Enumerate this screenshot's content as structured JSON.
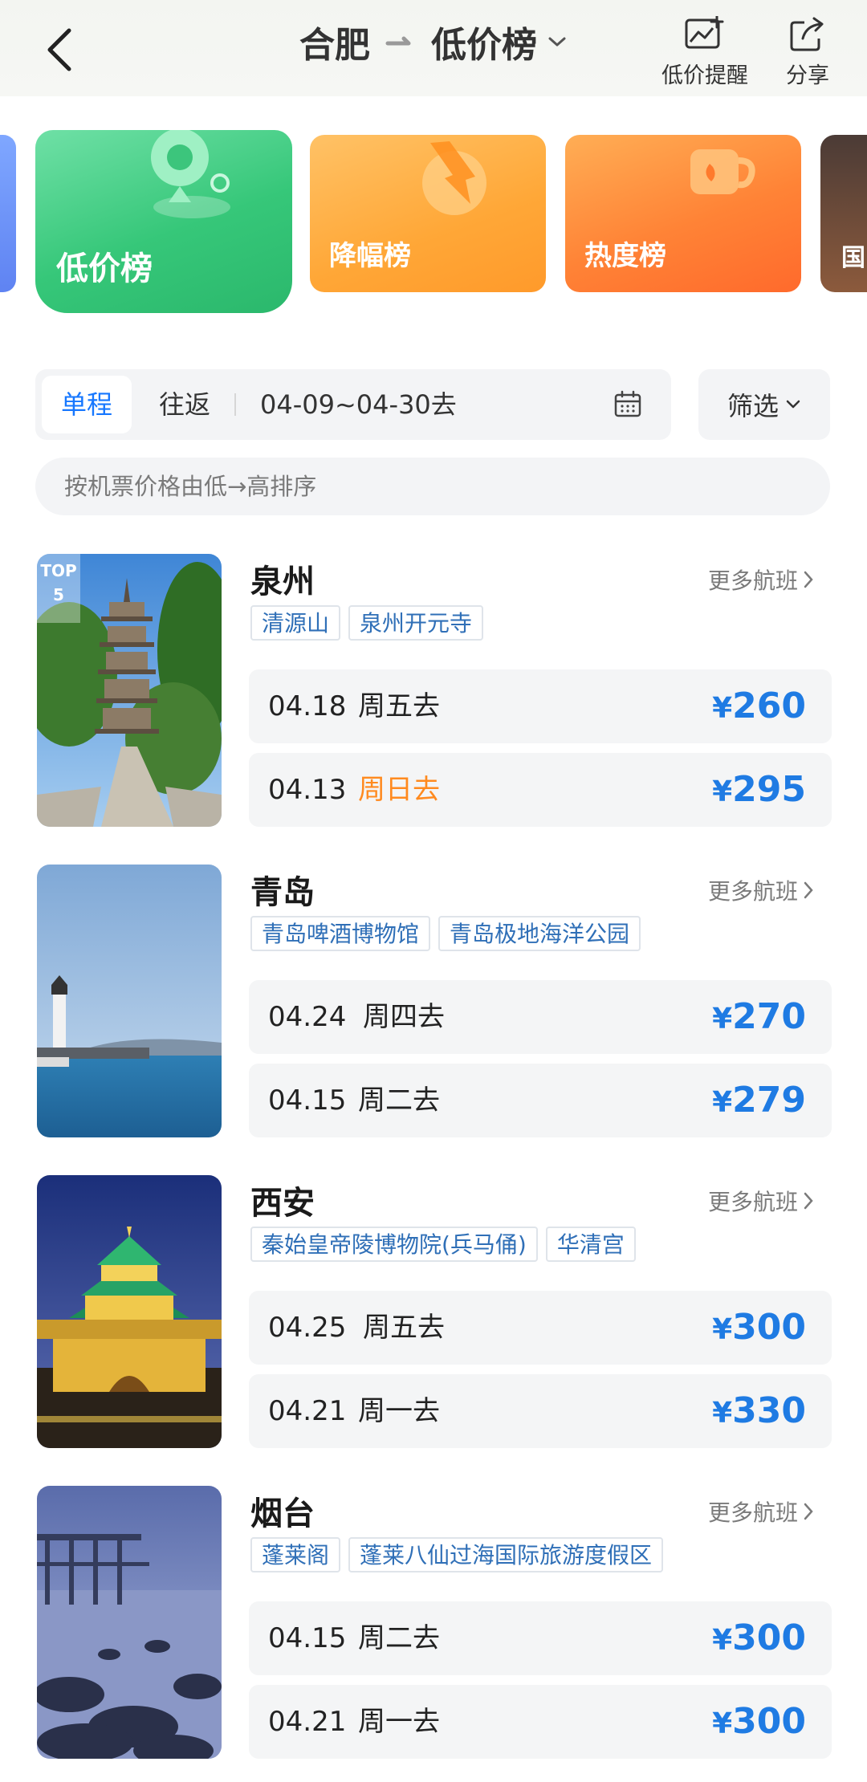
{
  "header": {
    "origin": "合肥",
    "title": "低价榜",
    "actions": {
      "alert_label": "低价提醒",
      "share_label": "分享"
    }
  },
  "ranks": {
    "low_price": "低价榜",
    "price_drop": "降幅榜",
    "popularity": "热度榜",
    "partial_next": "国"
  },
  "trip": {
    "one_way": "单程",
    "round_trip": "往返",
    "date_range": "04-09~04-30去",
    "filter": "筛选"
  },
  "sort_hint": "按机票价格由低→高排序",
  "more_label": "更多航班",
  "top_badge": {
    "line1": "TOP",
    "line2": "5"
  },
  "destinations": [
    {
      "name": "泉州",
      "tags": [
        "清源山",
        "泉州开元寺"
      ],
      "flights": [
        {
          "date": "04.18",
          "weekday": "周五去",
          "weekend": false,
          "currency": "¥",
          "price": "260"
        },
        {
          "date": "04.13",
          "weekday": "周日去",
          "weekend": true,
          "currency": "¥",
          "price": "295"
        }
      ]
    },
    {
      "name": "青岛",
      "tags": [
        "青岛啤酒博物馆",
        "青岛极地海洋公园"
      ],
      "flights": [
        {
          "date": "04.24",
          "weekday": "周四去",
          "weekend": false,
          "currency": "¥",
          "price": "270"
        },
        {
          "date": "04.15",
          "weekday": "周二去",
          "weekend": false,
          "currency": "¥",
          "price": "279"
        }
      ]
    },
    {
      "name": "西安",
      "tags": [
        "秦始皇帝陵博物院(兵马俑)",
        "华清宫"
      ],
      "flights": [
        {
          "date": "04.25",
          "weekday": "周五去",
          "weekend": false,
          "currency": "¥",
          "price": "300"
        },
        {
          "date": "04.21",
          "weekday": "周一去",
          "weekend": false,
          "currency": "¥",
          "price": "330"
        }
      ]
    },
    {
      "name": "烟台",
      "tags": [
        "蓬莱阁",
        "蓬莱八仙过海国际旅游度假区"
      ],
      "flights": [
        {
          "date": "04.15",
          "weekday": "周二去",
          "weekend": false,
          "currency": "¥",
          "price": "300"
        },
        {
          "date": "04.21",
          "weekday": "周一去",
          "weekend": false,
          "currency": "¥",
          "price": "300"
        }
      ]
    }
  ],
  "colors": {
    "accent": "#1677ff",
    "price": "#1f7be3",
    "weekend": "#ff8a1f",
    "tag_text": "#2f6fb7"
  }
}
